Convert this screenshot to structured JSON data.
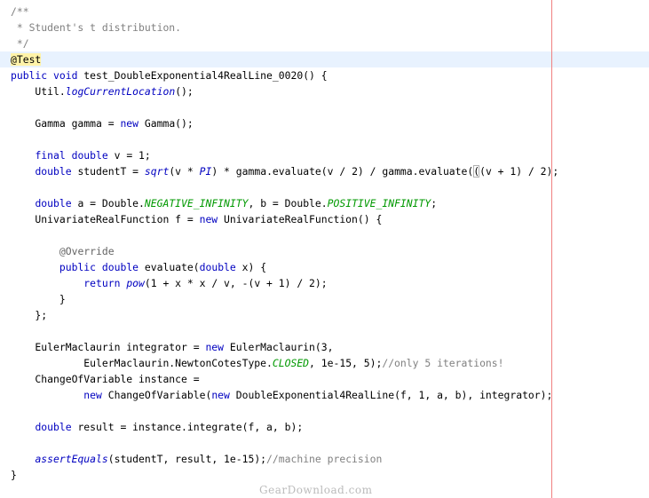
{
  "editor": {
    "lines": [
      [
        {
          "t": "/**",
          "c": "comment"
        }
      ],
      [
        {
          "t": " * Student's t distribution.",
          "c": "comment"
        }
      ],
      [
        {
          "t": " */",
          "c": "comment"
        }
      ],
      [
        {
          "t": "@Test",
          "c": "ann-hl"
        }
      ],
      [
        {
          "t": "public",
          "c": "kw"
        },
        {
          "t": " "
        },
        {
          "t": "void",
          "c": "kw"
        },
        {
          "t": " test_DoubleExponential4RealLine_0020() {"
        }
      ],
      [
        {
          "t": "    Util."
        },
        {
          "t": "logCurrentLocation",
          "c": "static"
        },
        {
          "t": "();"
        }
      ],
      [],
      [
        {
          "t": "    Gamma gamma = "
        },
        {
          "t": "new",
          "c": "kw"
        },
        {
          "t": " Gamma();"
        }
      ],
      [],
      [
        {
          "t": "    "
        },
        {
          "t": "final",
          "c": "kw"
        },
        {
          "t": " "
        },
        {
          "t": "double",
          "c": "kw"
        },
        {
          "t": " v = 1;"
        }
      ],
      [
        {
          "t": "    "
        },
        {
          "t": "double",
          "c": "kw"
        },
        {
          "t": " studentT = "
        },
        {
          "t": "sqrt",
          "c": "static"
        },
        {
          "t": "(v * "
        },
        {
          "t": "PI",
          "c": "static"
        },
        {
          "t": ") * gamma.evaluate(v / 2) / gamma.evaluate("
        },
        {
          "t": "(",
          "c": "bracket"
        },
        {
          "t": "(v + 1) / 2);"
        }
      ],
      [],
      [
        {
          "t": "    "
        },
        {
          "t": "double",
          "c": "kw"
        },
        {
          "t": " a = Double."
        },
        {
          "t": "NEGATIVE_INFINITY",
          "c": "constant"
        },
        {
          "t": ", b = Double."
        },
        {
          "t": "POSITIVE_INFINITY",
          "c": "constant"
        },
        {
          "t": ";"
        }
      ],
      [
        {
          "t": "    UnivariateRealFunction f = "
        },
        {
          "t": "new",
          "c": "kw"
        },
        {
          "t": " UnivariateRealFunction() {"
        }
      ],
      [],
      [
        {
          "t": "        "
        },
        {
          "t": "@Override",
          "c": "annotation"
        }
      ],
      [
        {
          "t": "        "
        },
        {
          "t": "public",
          "c": "kw"
        },
        {
          "t": " "
        },
        {
          "t": "double",
          "c": "kw"
        },
        {
          "t": " evaluate("
        },
        {
          "t": "double",
          "c": "kw"
        },
        {
          "t": " x) {"
        }
      ],
      [
        {
          "t": "            "
        },
        {
          "t": "return",
          "c": "kw"
        },
        {
          "t": " "
        },
        {
          "t": "pow",
          "c": "static"
        },
        {
          "t": "(1 + x * x / v, -(v + 1) / 2);"
        }
      ],
      [
        {
          "t": "        }"
        }
      ],
      [
        {
          "t": "    };"
        }
      ],
      [],
      [
        {
          "t": "    EulerMaclaurin integrator = "
        },
        {
          "t": "new",
          "c": "kw"
        },
        {
          "t": " EulerMaclaurin(3,"
        }
      ],
      [
        {
          "t": "            EulerMaclaurin.NewtonCotesType."
        },
        {
          "t": "CLOSED",
          "c": "constant"
        },
        {
          "t": ", 1e-15, 5);"
        },
        {
          "t": "//only 5 iterations!",
          "c": "comment"
        }
      ],
      [
        {
          "t": "    ChangeOfVariable instance ="
        }
      ],
      [
        {
          "t": "            "
        },
        {
          "t": "new",
          "c": "kw"
        },
        {
          "t": " ChangeOfVariable("
        },
        {
          "t": "new",
          "c": "kw"
        },
        {
          "t": " DoubleExponential4RealLine(f, 1, a, b), integrator);"
        }
      ],
      [],
      [
        {
          "t": "    "
        },
        {
          "t": "double",
          "c": "kw"
        },
        {
          "t": " result = instance.integrate(f, a, b);"
        }
      ],
      [],
      [
        {
          "t": "    "
        },
        {
          "t": "assertEquals",
          "c": "static"
        },
        {
          "t": "(studentT, result, 1e-15);"
        },
        {
          "t": "//machine precision",
          "c": "comment"
        }
      ],
      [
        {
          "t": "}"
        }
      ]
    ],
    "current_line": 3
  },
  "watermark": "GearDownload.com"
}
